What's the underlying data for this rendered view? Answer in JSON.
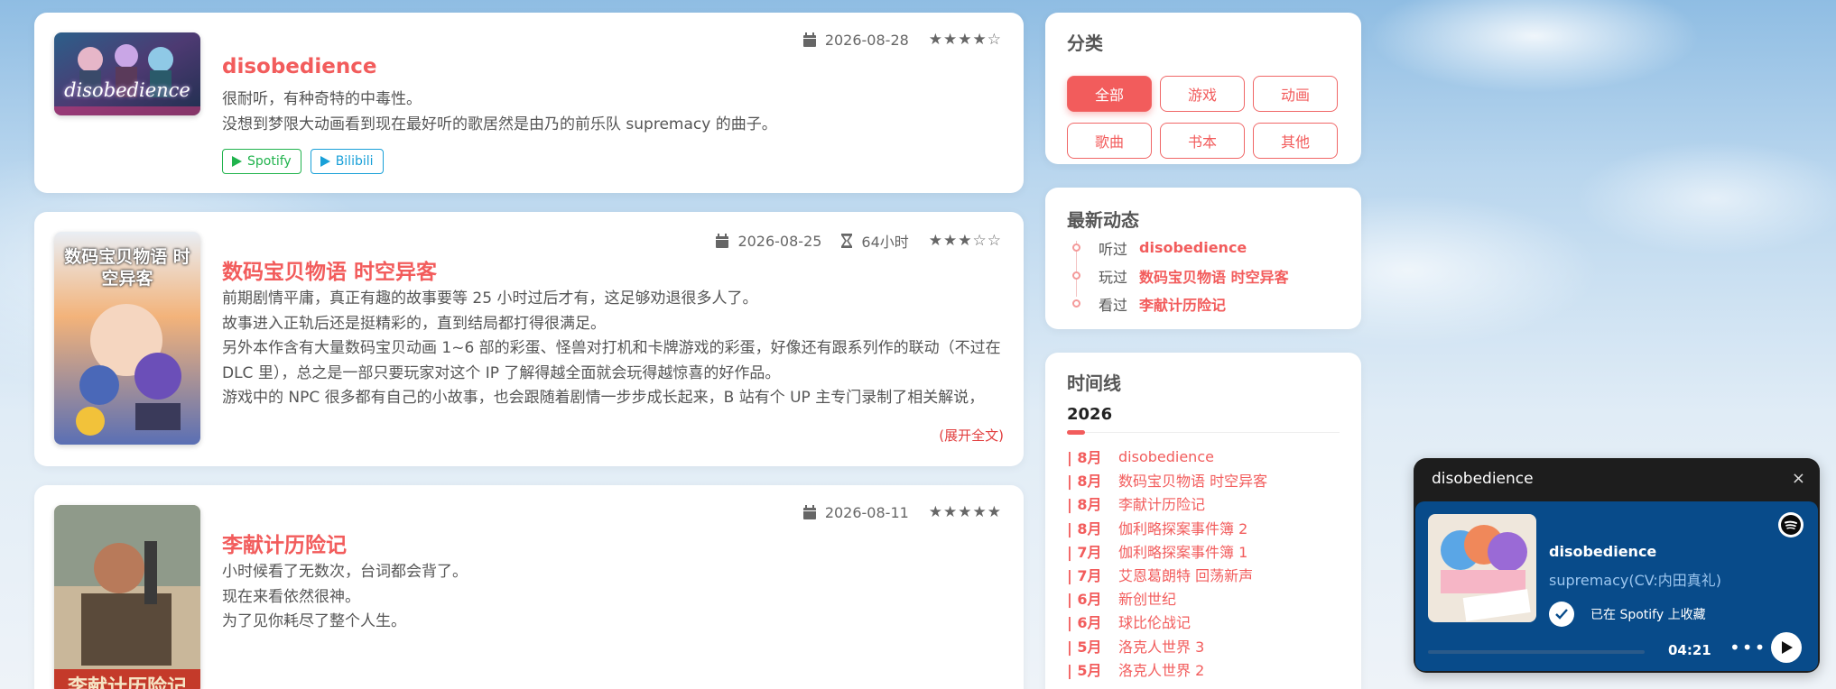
{
  "posts": [
    {
      "date": "2026-08-28",
      "stars": "★★★★☆",
      "title": "disobedience",
      "body": [
        "很耐听，有种奇特的中毒性。",
        "没想到梦限大动画看到现在最好听的歌居然是由乃的前乐队 supremacy 的曲子。"
      ],
      "links": [
        "Spotify",
        "Bilibili"
      ],
      "cover_text": "disobedience"
    },
    {
      "date": "2026-08-25",
      "duration": "64小时",
      "stars": "★★★☆☆",
      "title": "数码宝贝物语 时空异客",
      "body": [
        "前期剧情平庸，真正有趣的故事要等 25 小时过后才有，这足够劝退很多人了。",
        "故事进入正轨后还是挺精彩的，直到结局都打得很满足。",
        "另外本作含有大量数码宝贝动画 1~6 部的彩蛋、怪兽对打机和卡牌游戏的彩蛋，好像还有跟系列作的联动（不过在 DLC 里），总之是一部只要玩家对这个 IP 了解得越全面就会玩得越惊喜的好作品。",
        "游戏中的 NPC 很多都有自己的小故事，也会跟随着剧情一步步成长起来，B 站有个 UP 主专门录制了相关解说，"
      ],
      "expand": "(展开全文)",
      "cover_text": "数码宝贝物语 时空异客"
    },
    {
      "date": "2026-08-11",
      "stars": "★★★★★",
      "title": "李献计历险记",
      "body": [
        "小时候看了无数次，台词都会背了。",
        "现在来看依然很神。",
        "为了见你耗尽了整个人生。"
      ],
      "cover_text": "李献计历险记"
    }
  ],
  "categories": {
    "title": "分类",
    "items": [
      "全部",
      "游戏",
      "动画",
      "歌曲",
      "书本",
      "其他"
    ],
    "active": "全部"
  },
  "activity": {
    "title": "最新动态",
    "items": [
      {
        "verb": "听过",
        "name": "disobedience"
      },
      {
        "verb": "玩过",
        "name": "数码宝贝物语 时空异客"
      },
      {
        "verb": "看过",
        "name": "李献计历险记"
      }
    ]
  },
  "timeline": {
    "title": "时间线",
    "year": "2026",
    "items": [
      {
        "month": "| 8月",
        "name": "disobedience"
      },
      {
        "month": "| 8月",
        "name": "数码宝贝物语 时空异客"
      },
      {
        "month": "| 8月",
        "name": "李献计历险记"
      },
      {
        "month": "| 8月",
        "name": "伽利略探案事件簿 2"
      },
      {
        "month": "| 7月",
        "name": "伽利略探案事件簿 1"
      },
      {
        "month": "| 7月",
        "name": "艾恩葛朗特 回荡新声"
      },
      {
        "month": "| 6月",
        "name": "新创世纪"
      },
      {
        "month": "| 6月",
        "name": "球比伦战记"
      },
      {
        "month": "| 5月",
        "name": "洛克人世界 3"
      },
      {
        "month": "| 5月",
        "name": "洛克人世界 2"
      }
    ]
  },
  "player": {
    "header": "disobedience",
    "close": "×",
    "title": "disobedience",
    "artist": "supremacy(CV:内田真礼)",
    "saved": "已在 Spotify 上收藏",
    "time": "04:21",
    "progress": 0,
    "more": "•••"
  },
  "colors": {
    "accent": "#f25c5c",
    "spotify": "#21b34d",
    "bilibili": "#19a0d8",
    "player_bg": "#084b8a"
  }
}
